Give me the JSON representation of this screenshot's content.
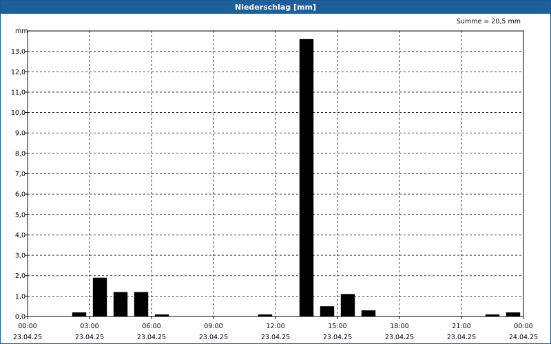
{
  "window": {
    "title": "Niederschlag [mm]"
  },
  "colors": {
    "titlebar": "#1d5f98",
    "bar": "#000000",
    "grid": "#000000"
  },
  "chart_data": {
    "type": "bar",
    "title": "Niederschlag [mm]",
    "ylabel": "mm",
    "annotation": "Summe = 20,5 mm",
    "ylim": [
      0,
      14
    ],
    "y_ticks": [
      "0,0",
      "1,0",
      "2,0",
      "3,0",
      "4,0",
      "5,0",
      "6,0",
      "7,0",
      "8,0",
      "9,0",
      "10,0",
      "11,0",
      "12,0",
      "13,0"
    ],
    "x_ticks": [
      {
        "time": "00:00",
        "date": "23.04.25"
      },
      {
        "time": "03:00",
        "date": "23.04.25"
      },
      {
        "time": "06:00",
        "date": "23.04.25"
      },
      {
        "time": "09:00",
        "date": "23.04.25"
      },
      {
        "time": "12:00",
        "date": "23.04.25"
      },
      {
        "time": "15:00",
        "date": "23.04.25"
      },
      {
        "time": "18:00",
        "date": "23.04.25"
      },
      {
        "time": "21:00",
        "date": "23.04.25"
      },
      {
        "time": "00:00",
        "date": "24.04.25"
      }
    ],
    "x_range_hours": [
      0,
      24
    ],
    "grid": true,
    "legend": "none",
    "series": [
      {
        "values": [
          {
            "hour": 2,
            "value": 0.2
          },
          {
            "hour": 3,
            "value": 1.9
          },
          {
            "hour": 4,
            "value": 1.2
          },
          {
            "hour": 5,
            "value": 1.2
          },
          {
            "hour": 6,
            "value": 0.1
          },
          {
            "hour": 11,
            "value": 0.1
          },
          {
            "hour": 13,
            "value": 13.6
          },
          {
            "hour": 14,
            "value": 0.5
          },
          {
            "hour": 15,
            "value": 1.1
          },
          {
            "hour": 16,
            "value": 0.3
          },
          {
            "hour": 22,
            "value": 0.1
          },
          {
            "hour": 23,
            "value": 0.2
          }
        ]
      }
    ]
  }
}
